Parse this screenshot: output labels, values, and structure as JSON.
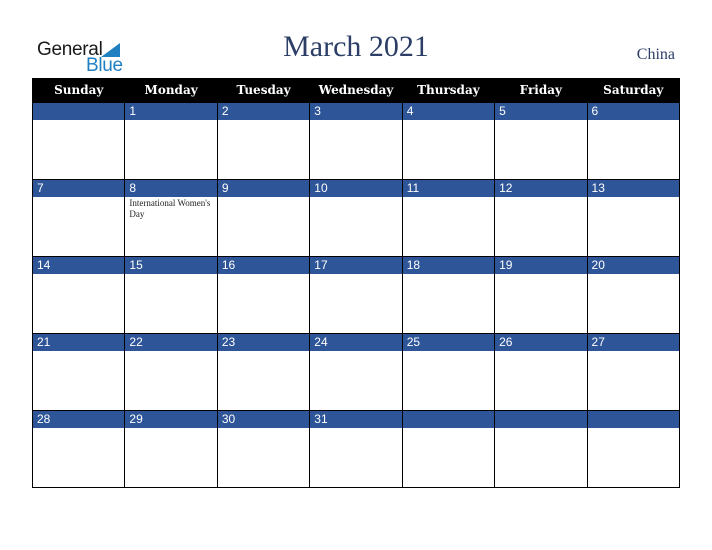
{
  "logo": {
    "line1": "General",
    "line2": "Blue",
    "icon": "triangle-flag-icon"
  },
  "title": "March 2021",
  "country": "China",
  "colors": {
    "header_bg": "#000000",
    "day_band": "#2e5597",
    "title": "#2c3e66",
    "logo_blue": "#1f7fc1"
  },
  "weekdays": [
    "Sunday",
    "Monday",
    "Tuesday",
    "Wednesday",
    "Thursday",
    "Friday",
    "Saturday"
  ],
  "weeks": [
    [
      {
        "day": ""
      },
      {
        "day": "1"
      },
      {
        "day": "2"
      },
      {
        "day": "3"
      },
      {
        "day": "4"
      },
      {
        "day": "5"
      },
      {
        "day": "6"
      }
    ],
    [
      {
        "day": "7"
      },
      {
        "day": "8",
        "event": "International Women's Day"
      },
      {
        "day": "9"
      },
      {
        "day": "10"
      },
      {
        "day": "11"
      },
      {
        "day": "12"
      },
      {
        "day": "13"
      }
    ],
    [
      {
        "day": "14"
      },
      {
        "day": "15"
      },
      {
        "day": "16"
      },
      {
        "day": "17"
      },
      {
        "day": "18"
      },
      {
        "day": "19"
      },
      {
        "day": "20"
      }
    ],
    [
      {
        "day": "21"
      },
      {
        "day": "22"
      },
      {
        "day": "23"
      },
      {
        "day": "24"
      },
      {
        "day": "25"
      },
      {
        "day": "26"
      },
      {
        "day": "27"
      }
    ],
    [
      {
        "day": "28"
      },
      {
        "day": "29"
      },
      {
        "day": "30"
      },
      {
        "day": "31"
      },
      {
        "day": ""
      },
      {
        "day": ""
      },
      {
        "day": ""
      }
    ]
  ]
}
